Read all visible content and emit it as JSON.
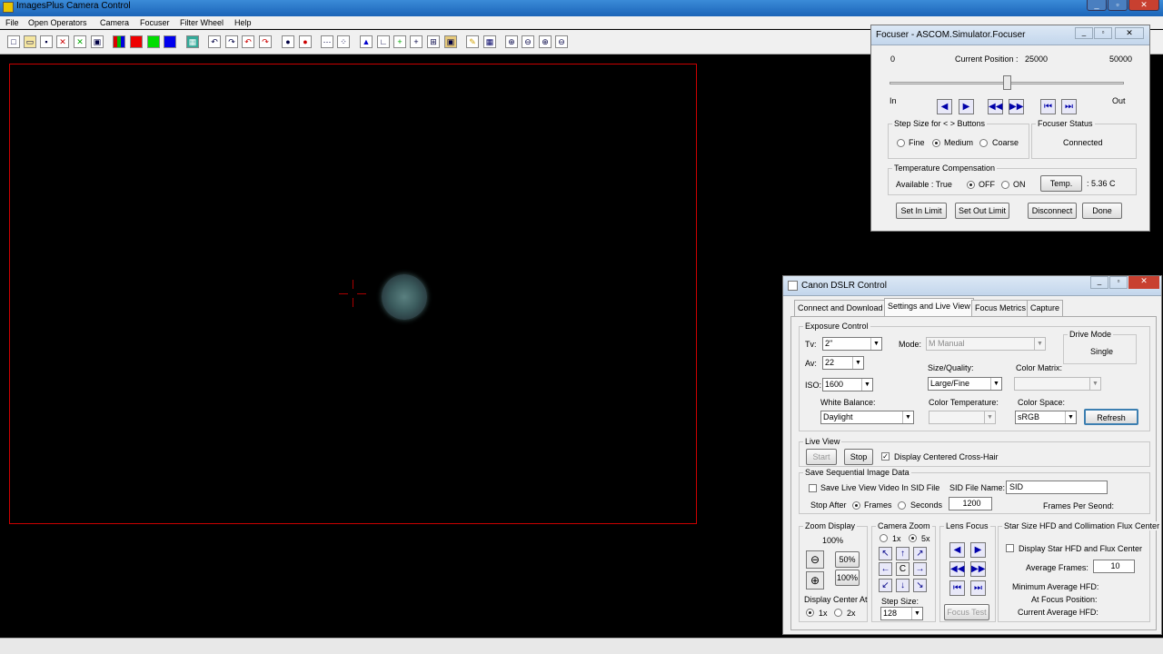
{
  "app": {
    "title": "ImagesPlus Camera Control"
  },
  "menu": [
    "File",
    "Open Operators",
    "Camera",
    "Focuser",
    "Filter Wheel",
    "Help"
  ],
  "focuser": {
    "title": "Focuser - ASCOM.Simulator.Focuser",
    "min": "0",
    "current_label": "Current Position :",
    "current": "25000",
    "max": "50000",
    "position_fraction": 0.5,
    "in": "In",
    "out": "Out",
    "step_group": "Step Size for < > Buttons",
    "fine": "Fine",
    "medium": "Medium",
    "coarse": "Coarse",
    "status_group": "Focuser Status",
    "status": "Connected",
    "temp_group": "Temperature Compensation",
    "available": "Available : True",
    "off": "OFF",
    "on": "ON",
    "temp_button": "Temp.",
    "temp_value": ": 5.36 C",
    "set_in": "Set In Limit",
    "set_out": "Set Out Limit",
    "disconnect": "Disconnect",
    "done": "Done"
  },
  "dslr": {
    "title": "Canon DSLR Control",
    "tabs": [
      "Connect and Download",
      "Settings and Live View",
      "Focus Metrics",
      "Capture"
    ],
    "exposure_group": "Exposure Control",
    "tv_label": "Tv:",
    "tv": "2\"",
    "av_label": "Av:",
    "av": "22",
    "iso_label": "ISO:",
    "iso": "1600",
    "mode_label": "Mode:",
    "mode": "M Manual",
    "drive_group": "Drive Mode",
    "drive": "Single",
    "size_label": "Size/Quality:",
    "size": "Large/Fine",
    "matrix_label": "Color Matrix:",
    "wb_label": "White Balance:",
    "wb": "Daylight",
    "ct_label": "Color Temperature:",
    "cs_label": "Color Space:",
    "cs": "sRGB",
    "refresh": "Refresh",
    "live_group": "Live View",
    "start": "Start",
    "stop": "Stop",
    "crosshair": "Display Centered Cross-Hair",
    "sid_group": "Save Sequential Image Data",
    "save_sid": "Save Live View Video In SID File",
    "sid_name_label": "SID File Name:",
    "sid_name": "SID",
    "stop_after": "Stop After",
    "frames": "Frames",
    "seconds": "Seconds",
    "stop_value": "1200",
    "fps": "Frames Per Seond:",
    "zoom_group": "Zoom Display",
    "zoom_pct": "100%",
    "z50": "50%",
    "z100": "100%",
    "center_at": "Display Center At",
    "c1": "1x",
    "c2": "2x",
    "camzoom_group": "Camera Zoom",
    "cz1": "1x",
    "cz5": "5x",
    "center": "C",
    "step_label": "Step Size:",
    "step": "128",
    "lens_group": "Lens Focus",
    "focus_test": "Focus Test",
    "hfd_group": "Star Size HFD and Collimation Flux Center",
    "hfd_display": "Display Star HFD and Flux Center",
    "avg_frames_label": "Average Frames:",
    "avg_frames": "10",
    "min_hfd": "Minimum Average HFD:",
    "at_focus": "At Focus Position:",
    "cur_hfd": "Current Average HFD:"
  }
}
